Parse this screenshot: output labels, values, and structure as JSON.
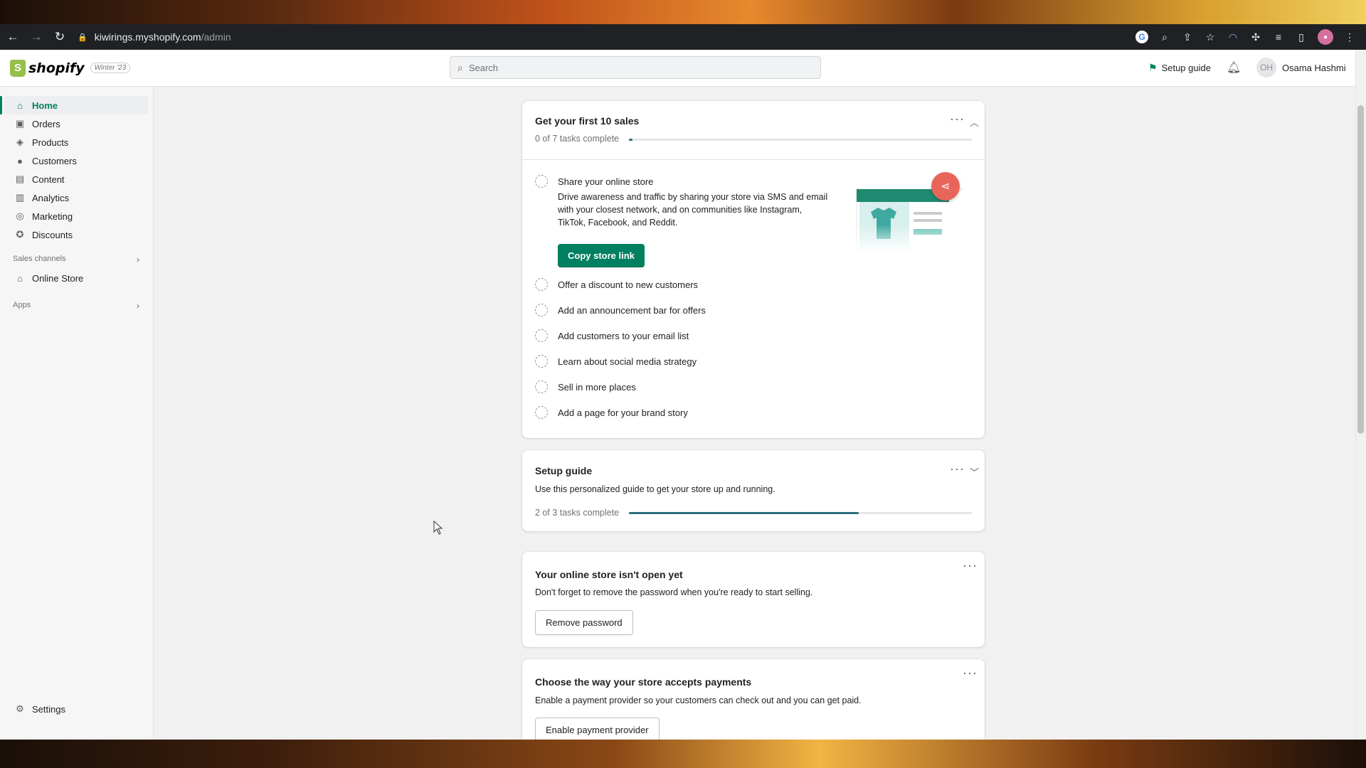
{
  "browser": {
    "url_host": "kiwirings.myshopify.com",
    "url_path": "/admin"
  },
  "topbar": {
    "brand": "shopify",
    "edition": "Winter '23",
    "search_placeholder": "Search",
    "setup_guide": "Setup guide",
    "user_initials": "OH",
    "user_name": "Osama Hashmi"
  },
  "sidebar": {
    "items": [
      {
        "label": "Home",
        "icon": "home-icon"
      },
      {
        "label": "Orders",
        "icon": "orders-icon"
      },
      {
        "label": "Products",
        "icon": "tag-icon"
      },
      {
        "label": "Customers",
        "icon": "person-icon"
      },
      {
        "label": "Content",
        "icon": "content-icon"
      },
      {
        "label": "Analytics",
        "icon": "chart-icon"
      },
      {
        "label": "Marketing",
        "icon": "target-icon"
      },
      {
        "label": "Discounts",
        "icon": "discount-icon"
      }
    ],
    "sales_channels_label": "Sales channels",
    "online_store": "Online Store",
    "apps_label": "Apps",
    "settings": "Settings"
  },
  "cards": {
    "first_sales": {
      "title": "Get your first 10 sales",
      "progress_text": "0 of 7 tasks complete",
      "progress_fraction": 0.01,
      "share_title": "Share your online store",
      "share_desc": "Drive awareness and traffic by sharing your store via SMS and email with your closest network, and on communities like Instagram, TikTok, Facebook, and Reddit.",
      "copy_button": "Copy store link",
      "tasks": [
        "Offer a discount to new customers",
        "Add an announcement bar for offers",
        "Add customers to your email list",
        "Learn about social media strategy",
        "Sell in more places",
        "Add a page for your brand story"
      ]
    },
    "setup": {
      "title": "Setup guide",
      "desc": "Use this personalized guide to get your store up and running.",
      "progress_text": "2 of 3 tasks complete",
      "progress_fraction": 0.67
    },
    "store_closed": {
      "title": "Your online store isn't open yet",
      "desc": "Don't forget to remove the password when you're ready to start selling.",
      "button": "Remove password"
    },
    "payments": {
      "title": "Choose the way your store accepts payments",
      "desc": "Enable a payment provider so your customers can check out and you can get paid.",
      "button": "Enable payment provider"
    }
  },
  "colors": {
    "accent": "#008060",
    "progress": "#2c6e7f",
    "share_badge": "#e8655a"
  }
}
